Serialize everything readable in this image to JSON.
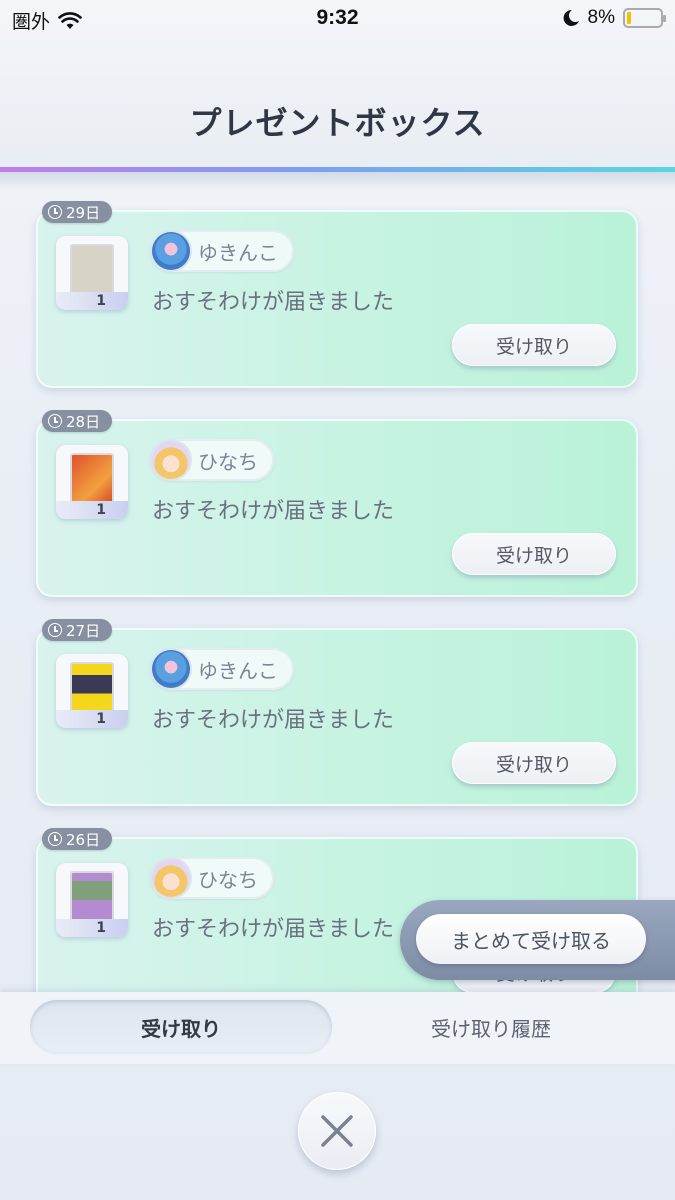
{
  "status_bar": {
    "carrier": "圏外",
    "time": "9:32",
    "battery_percent": "8%",
    "icons": [
      "wifi-icon",
      "moon-icon",
      "battery-icon"
    ]
  },
  "header": {
    "title": "プレゼントボックス"
  },
  "presents": [
    {
      "days": "29日",
      "sender": "ゆきんこ",
      "avatar": "blue",
      "card_color": "#d8d3c7",
      "count": "1",
      "message": "おすそわけが届きました",
      "button": "受け取り"
    },
    {
      "days": "28日",
      "sender": "ひなち",
      "avatar": "girl",
      "card_color": "#e0522a",
      "count": "1",
      "message": "おすそわけが届きました",
      "button": "受け取り"
    },
    {
      "days": "27日",
      "sender": "ゆきんこ",
      "avatar": "blue",
      "card_color": "#f4d61c",
      "count": "1",
      "message": "おすそわけが届きました",
      "button": "受け取り"
    },
    {
      "days": "26日",
      "sender": "ひなち",
      "avatar": "girl",
      "card_color": "#b58bd0",
      "count": "1",
      "message": "おすそわけが届きました",
      "button": "受け取り"
    }
  ],
  "bulk_button": "まとめて受け取る",
  "tabs": [
    {
      "label": "受け取り",
      "active": true
    },
    {
      "label": "受け取り履歴",
      "active": false
    }
  ],
  "close_icon": "close-icon"
}
